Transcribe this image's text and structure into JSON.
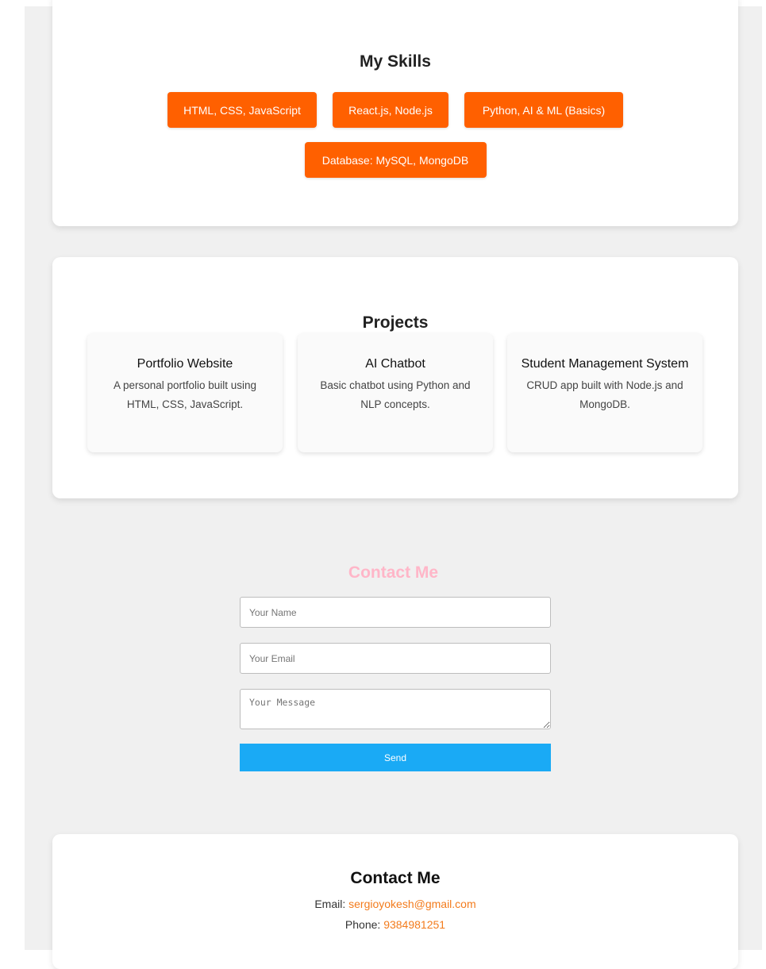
{
  "skills": {
    "title": "My Skills",
    "items": [
      "HTML, CSS, JavaScript",
      "React.js, Node.js",
      "Python, AI & ML (Basics)",
      "Database: MySQL, MongoDB"
    ]
  },
  "projects": {
    "title": "Projects",
    "items": [
      {
        "title": "Portfolio Website",
        "description": "A personal portfolio built using HTML, CSS, JavaScript."
      },
      {
        "title": "AI Chatbot",
        "description": "Basic chatbot using Python and NLP concepts."
      },
      {
        "title": "Student Management System",
        "description": "CRUD app built with Node.js and MongoDB."
      }
    ]
  },
  "contact_form": {
    "title": "Contact Me",
    "name_placeholder": "Your Name",
    "email_placeholder": "Your Email",
    "message_placeholder": "Your Message",
    "send_label": "Send"
  },
  "footer": {
    "title": "Contact Me",
    "email_label": "Email:",
    "email_value": "sergioyokesh@gmail.com",
    "phone_label": "Phone:",
    "phone_value": "9384981251"
  },
  "colors": {
    "skill_button": "#ff6000",
    "send_button": "#1aaaf5",
    "contact_title": "#ffb6c8",
    "link_accent": "#f37b1c",
    "page_background": "#f0f0f0"
  }
}
